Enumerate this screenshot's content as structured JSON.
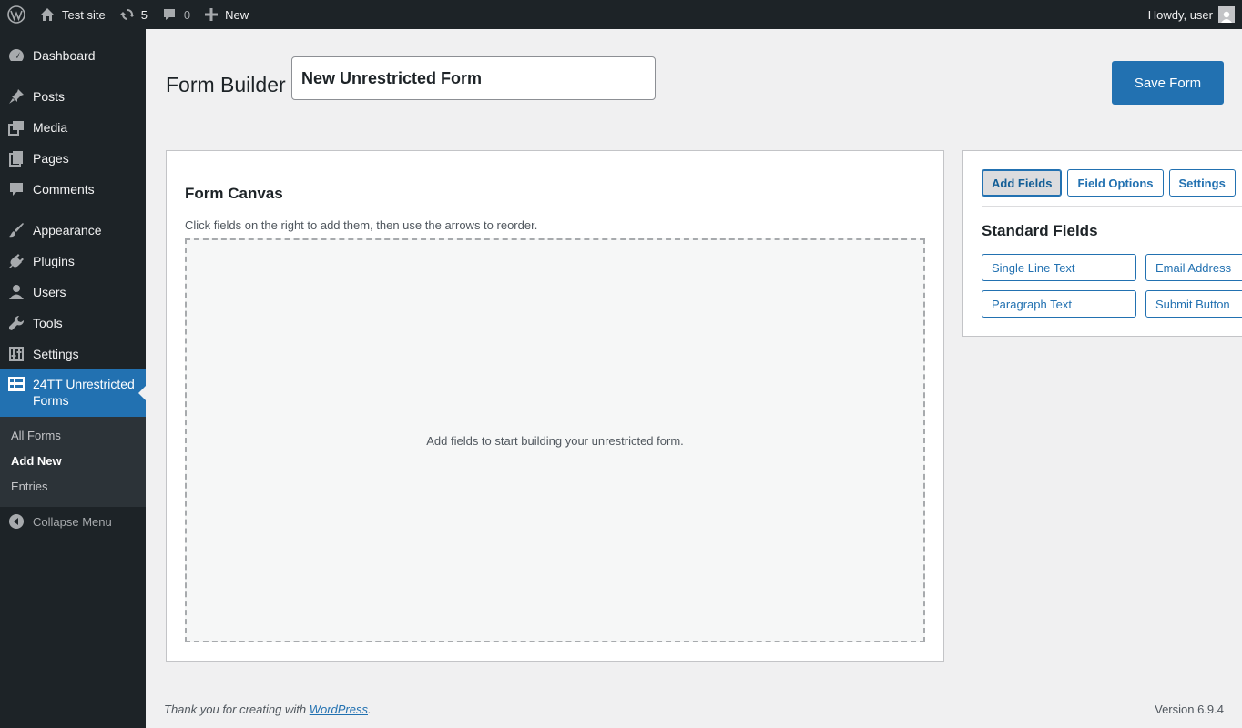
{
  "adminbar": {
    "site_name": "Test site",
    "updates_count": "5",
    "comments_count": "0",
    "new_label": "New",
    "howdy": "Howdy, user"
  },
  "menu": {
    "items": [
      {
        "label": "Dashboard",
        "icon": "dashboard-icon"
      },
      {
        "label": "Posts",
        "icon": "pin-icon"
      },
      {
        "label": "Media",
        "icon": "media-icon"
      },
      {
        "label": "Pages",
        "icon": "pages-icon"
      },
      {
        "label": "Comments",
        "icon": "comment-icon"
      },
      {
        "label": "Appearance",
        "icon": "brush-icon"
      },
      {
        "label": "Plugins",
        "icon": "plug-icon"
      },
      {
        "label": "Users",
        "icon": "user-icon"
      },
      {
        "label": "Tools",
        "icon": "wrench-icon"
      },
      {
        "label": "Settings",
        "icon": "sliders-icon"
      }
    ],
    "current": {
      "line1": "24TT Unrestricted",
      "line2": "Forms"
    },
    "submenu": [
      "All Forms",
      "Add New",
      "Entries"
    ],
    "collapse": "Collapse Menu"
  },
  "page": {
    "title": "Form Builder",
    "form_name": "New Unrestricted Form",
    "save_label": "Save Form"
  },
  "canvas": {
    "heading": "Form Canvas",
    "hint": "Click fields on the right to add them, then use the arrows to reorder.",
    "empty": "Add fields to start building your unrestricted form."
  },
  "sidebar": {
    "tabs": [
      "Add Fields",
      "Field Options",
      "Settings"
    ],
    "active_tab": "Add Fields",
    "section": "Standard Fields",
    "fields": [
      "Single Line Text",
      "Email Address",
      "Paragraph Text",
      "Submit Button"
    ]
  },
  "footer": {
    "thanks_prefix": "Thank you for creating with ",
    "link": "WordPress",
    "suffix": ".",
    "version": "Version 6.9.4"
  },
  "colors": {
    "accent": "#2271b1",
    "adminbar": "#1d2327"
  }
}
